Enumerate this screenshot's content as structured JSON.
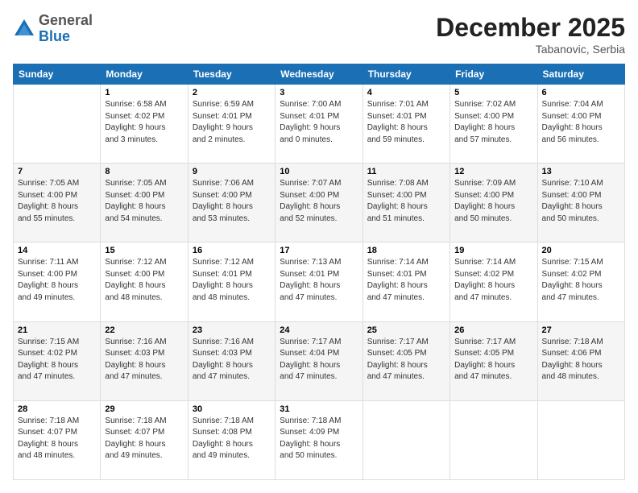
{
  "header": {
    "logo_general": "General",
    "logo_blue": "Blue",
    "month_title": "December 2025",
    "location": "Tabanovic, Serbia"
  },
  "calendar": {
    "headers": [
      "Sunday",
      "Monday",
      "Tuesday",
      "Wednesday",
      "Thursday",
      "Friday",
      "Saturday"
    ],
    "weeks": [
      [
        {
          "day": "",
          "info": ""
        },
        {
          "day": "1",
          "info": "Sunrise: 6:58 AM\nSunset: 4:02 PM\nDaylight: 9 hours\nand 3 minutes."
        },
        {
          "day": "2",
          "info": "Sunrise: 6:59 AM\nSunset: 4:01 PM\nDaylight: 9 hours\nand 2 minutes."
        },
        {
          "day": "3",
          "info": "Sunrise: 7:00 AM\nSunset: 4:01 PM\nDaylight: 9 hours\nand 0 minutes."
        },
        {
          "day": "4",
          "info": "Sunrise: 7:01 AM\nSunset: 4:01 PM\nDaylight: 8 hours\nand 59 minutes."
        },
        {
          "day": "5",
          "info": "Sunrise: 7:02 AM\nSunset: 4:00 PM\nDaylight: 8 hours\nand 57 minutes."
        },
        {
          "day": "6",
          "info": "Sunrise: 7:04 AM\nSunset: 4:00 PM\nDaylight: 8 hours\nand 56 minutes."
        }
      ],
      [
        {
          "day": "7",
          "info": "Sunrise: 7:05 AM\nSunset: 4:00 PM\nDaylight: 8 hours\nand 55 minutes."
        },
        {
          "day": "8",
          "info": "Sunrise: 7:05 AM\nSunset: 4:00 PM\nDaylight: 8 hours\nand 54 minutes."
        },
        {
          "day": "9",
          "info": "Sunrise: 7:06 AM\nSunset: 4:00 PM\nDaylight: 8 hours\nand 53 minutes."
        },
        {
          "day": "10",
          "info": "Sunrise: 7:07 AM\nSunset: 4:00 PM\nDaylight: 8 hours\nand 52 minutes."
        },
        {
          "day": "11",
          "info": "Sunrise: 7:08 AM\nSunset: 4:00 PM\nDaylight: 8 hours\nand 51 minutes."
        },
        {
          "day": "12",
          "info": "Sunrise: 7:09 AM\nSunset: 4:00 PM\nDaylight: 8 hours\nand 50 minutes."
        },
        {
          "day": "13",
          "info": "Sunrise: 7:10 AM\nSunset: 4:00 PM\nDaylight: 8 hours\nand 50 minutes."
        }
      ],
      [
        {
          "day": "14",
          "info": "Sunrise: 7:11 AM\nSunset: 4:00 PM\nDaylight: 8 hours\nand 49 minutes."
        },
        {
          "day": "15",
          "info": "Sunrise: 7:12 AM\nSunset: 4:00 PM\nDaylight: 8 hours\nand 48 minutes."
        },
        {
          "day": "16",
          "info": "Sunrise: 7:12 AM\nSunset: 4:01 PM\nDaylight: 8 hours\nand 48 minutes."
        },
        {
          "day": "17",
          "info": "Sunrise: 7:13 AM\nSunset: 4:01 PM\nDaylight: 8 hours\nand 47 minutes."
        },
        {
          "day": "18",
          "info": "Sunrise: 7:14 AM\nSunset: 4:01 PM\nDaylight: 8 hours\nand 47 minutes."
        },
        {
          "day": "19",
          "info": "Sunrise: 7:14 AM\nSunset: 4:02 PM\nDaylight: 8 hours\nand 47 minutes."
        },
        {
          "day": "20",
          "info": "Sunrise: 7:15 AM\nSunset: 4:02 PM\nDaylight: 8 hours\nand 47 minutes."
        }
      ],
      [
        {
          "day": "21",
          "info": "Sunrise: 7:15 AM\nSunset: 4:02 PM\nDaylight: 8 hours\nand 47 minutes."
        },
        {
          "day": "22",
          "info": "Sunrise: 7:16 AM\nSunset: 4:03 PM\nDaylight: 8 hours\nand 47 minutes."
        },
        {
          "day": "23",
          "info": "Sunrise: 7:16 AM\nSunset: 4:03 PM\nDaylight: 8 hours\nand 47 minutes."
        },
        {
          "day": "24",
          "info": "Sunrise: 7:17 AM\nSunset: 4:04 PM\nDaylight: 8 hours\nand 47 minutes."
        },
        {
          "day": "25",
          "info": "Sunrise: 7:17 AM\nSunset: 4:05 PM\nDaylight: 8 hours\nand 47 minutes."
        },
        {
          "day": "26",
          "info": "Sunrise: 7:17 AM\nSunset: 4:05 PM\nDaylight: 8 hours\nand 47 minutes."
        },
        {
          "day": "27",
          "info": "Sunrise: 7:18 AM\nSunset: 4:06 PM\nDaylight: 8 hours\nand 48 minutes."
        }
      ],
      [
        {
          "day": "28",
          "info": "Sunrise: 7:18 AM\nSunset: 4:07 PM\nDaylight: 8 hours\nand 48 minutes."
        },
        {
          "day": "29",
          "info": "Sunrise: 7:18 AM\nSunset: 4:07 PM\nDaylight: 8 hours\nand 49 minutes."
        },
        {
          "day": "30",
          "info": "Sunrise: 7:18 AM\nSunset: 4:08 PM\nDaylight: 8 hours\nand 49 minutes."
        },
        {
          "day": "31",
          "info": "Sunrise: 7:18 AM\nSunset: 4:09 PM\nDaylight: 8 hours\nand 50 minutes."
        },
        {
          "day": "",
          "info": ""
        },
        {
          "day": "",
          "info": ""
        },
        {
          "day": "",
          "info": ""
        }
      ]
    ]
  }
}
